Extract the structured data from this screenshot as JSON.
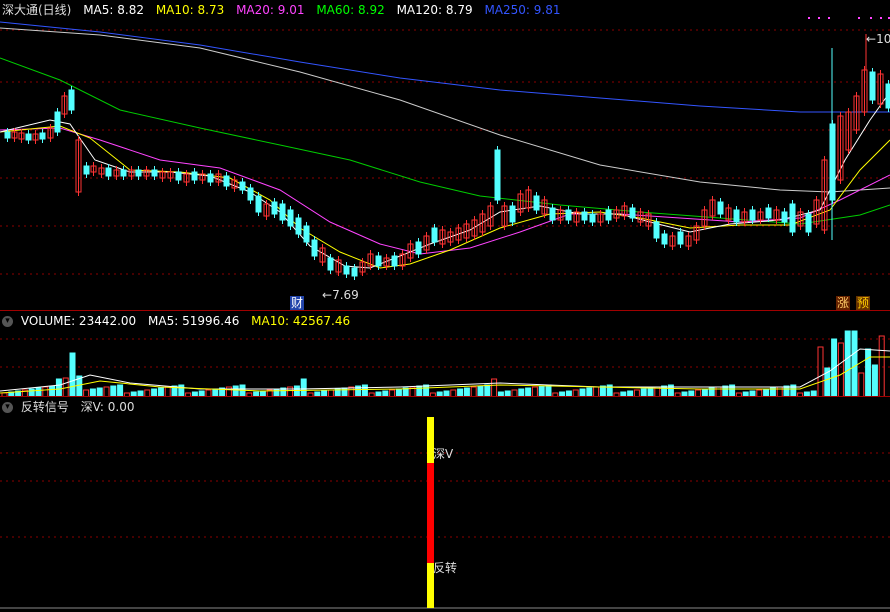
{
  "price_panel": {
    "title": "深大通(日线)",
    "indicators": [
      {
        "label": "MA5: 8.82",
        "color": "#ffffff"
      },
      {
        "label": "MA10: 8.73",
        "color": "#ffff00"
      },
      {
        "label": "MA20: 9.01",
        "color": "#ff44ff"
      },
      {
        "label": "MA60: 8.92",
        "color": "#00ff00"
      },
      {
        "label": "MA120: 8.79",
        "color": "#ffffff"
      },
      {
        "label": "MA250: 9.81",
        "color": "#3355ff"
      }
    ],
    "low_marker": "7.69",
    "high_marker": "10",
    "event_cai": "财",
    "event_zhang": "涨",
    "event_yu": "预"
  },
  "volume_panel": {
    "indicators": [
      {
        "label": "VOLUME: 23442.00",
        "color": "#ffffff"
      },
      {
        "label": "MA5: 51996.46",
        "color": "#ffffff"
      },
      {
        "label": "MA10: 42567.46",
        "color": "#ffff00"
      }
    ]
  },
  "signal_panel": {
    "title": "反转信号",
    "value_label": "深V: 0.00",
    "label_shenv": "深V",
    "label_fanzhuan": "反转"
  },
  "colors": {
    "up": "#ff3333",
    "down": "#54ffff",
    "ma5": "#ffffff",
    "ma10": "#ffff00",
    "ma20": "#ff44ff",
    "ma60": "#00cc00",
    "ma120": "#cccccc",
    "ma250": "#3355ff",
    "grid": "#8b0000"
  }
}
